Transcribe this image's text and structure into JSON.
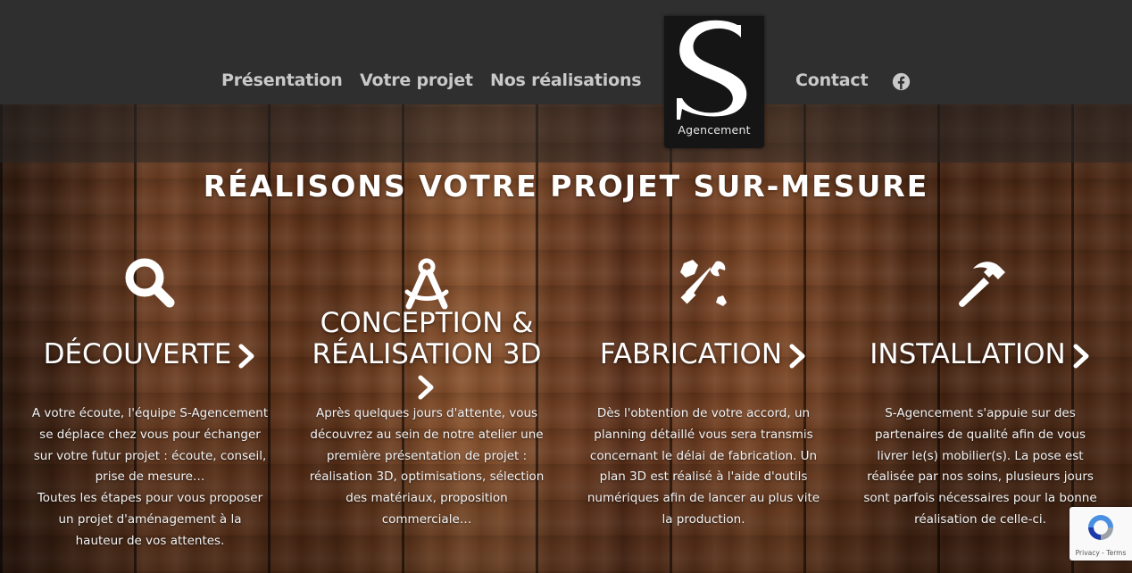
{
  "nav": {
    "items": [
      {
        "label": "Présentation"
      },
      {
        "label": "Votre projet"
      },
      {
        "label": "Nos réalisations"
      }
    ],
    "contact_label": "Contact",
    "social_icon": "facebook-icon"
  },
  "logo": {
    "letter": "S",
    "text": "Agencement"
  },
  "section": {
    "title": "RÉALISONS VOTRE PROJET SUR-MESURE"
  },
  "steps": [
    {
      "icon": "search-icon",
      "title": "DÉCOUVERTE",
      "text_lines": [
        "A votre écoute, l'équipe S-Agencement",
        "se déplace chez vous pour échanger",
        "sur votre futur projet : écoute, conseil,",
        "prise de mesure…",
        "Toutes les étapes pour vous proposer",
        "un projet d'aménagement à la",
        "hauteur de vos attentes."
      ]
    },
    {
      "icon": "compass-drafting-icon",
      "title_line1": "CONCEPTION &",
      "title_line2": "RÉALISATION 3D",
      "text_lines": [
        "Après quelques jours d'attente, vous",
        "découvrez au sein de notre atelier une",
        "première présentation de projet :",
        "réalisation 3D, optimisations, sélection",
        "des matériaux, proposition",
        "commerciale…"
      ]
    },
    {
      "icon": "tools-icon",
      "title": "FABRICATION",
      "text_lines": [
        "Dès l'obtention de votre accord, un",
        "planning détaillé vous sera transmis",
        "concernant le délai de fabrication. Un",
        "plan 3D est réalisé à l'aide d'outils",
        "numériques afin de lancer au plus vite",
        "la production."
      ]
    },
    {
      "icon": "hammer-icon",
      "title": "INSTALLATION",
      "text_lines": [
        "S-Agencement s'appuie sur des",
        "partenaires de qualité afin de vous",
        "livrer le(s) mobilier(s). La pose est",
        "réalisée par nos soins, plusieurs jours",
        "sont parfois nécessaires pour la bonne",
        "réalisation de celle-ci."
      ]
    }
  ],
  "recaptcha": {
    "legal": "Privacy - Terms"
  },
  "colors": {
    "header_bg": "#2f2f2f",
    "nav_text": "#c9c9c9",
    "logo_bg": "#151515"
  }
}
